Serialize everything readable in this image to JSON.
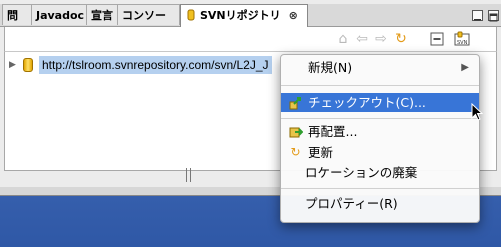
{
  "tabs": [
    {
      "label": "問題"
    },
    {
      "label": "Javadoc"
    },
    {
      "label": "宣言"
    },
    {
      "label": "コンソール"
    },
    {
      "label": "SVNリポジトリ",
      "active": true
    }
  ],
  "tree": {
    "repository_url": "http://tslroom.svnrepository.com/svn/L2J_J"
  },
  "context_menu": {
    "items": [
      {
        "label": "新規(N)",
        "submenu": true
      },
      {
        "label": "チェックアウト(C)...",
        "icon": "checkout-icon",
        "highlighted": true
      },
      {
        "label": "再配置...",
        "icon": "relocate-icon"
      },
      {
        "label": "更新",
        "icon": "refresh-icon"
      },
      {
        "label": "ロケーションの廃棄"
      },
      {
        "label": "プロパティー(R)"
      }
    ]
  },
  "colors": {
    "highlight": "#3875d7",
    "selection": "#b5d0ef",
    "desktop": "#4069b6"
  }
}
